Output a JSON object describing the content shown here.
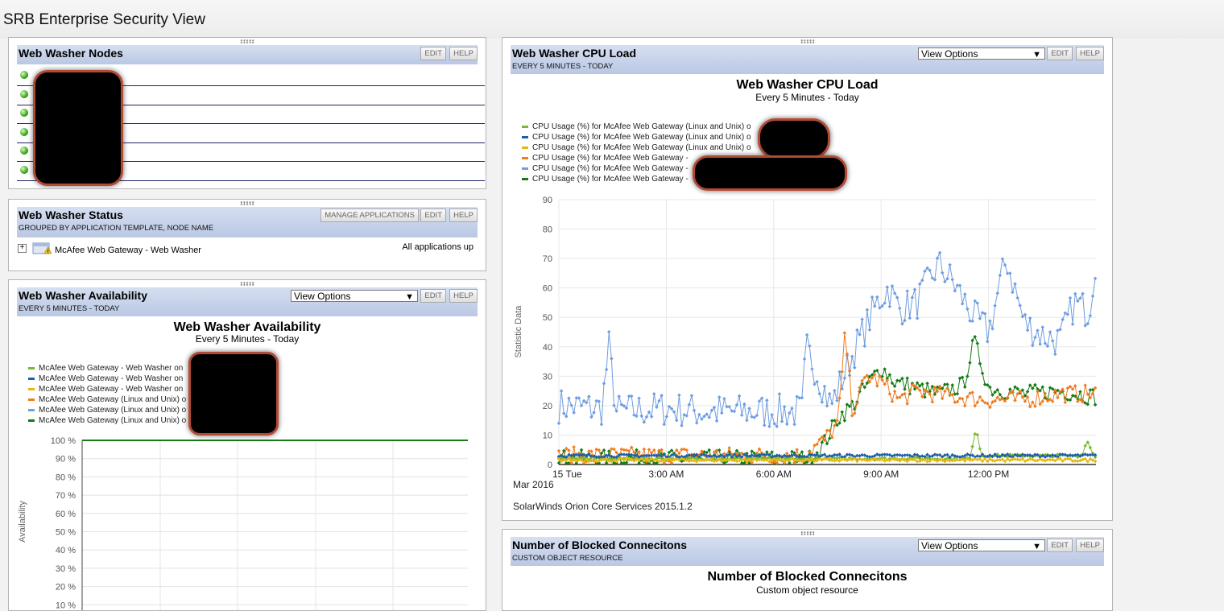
{
  "page": {
    "title": "SRB Enterprise Security View"
  },
  "common": {
    "edit": "EDIT",
    "help": "HELP",
    "view_options": "View Options"
  },
  "nodes_panel": {
    "title": "Web Washer Nodes",
    "row_count": 6
  },
  "status_panel": {
    "title": "Web Washer Status",
    "subtitle": "GROUPED BY APPLICATION TEMPLATE, NODE NAME",
    "manage_label": "MANAGE APPLICATIONS",
    "group_label": "McAfee Web Gateway - Web Washer",
    "status_text": "All applications up"
  },
  "availability_panel": {
    "title": "Web Washer Availability",
    "subtitle": "EVERY 5 MINUTES - TODAY",
    "chart_title": "Web Washer Availability",
    "chart_subtitle": "Every 5 Minutes - Today",
    "legend": [
      {
        "label": "McAfee Web Gateway - Web Washer on",
        "color": "#7cb82f"
      },
      {
        "label": "McAfee Web Gateway - Web Washer on",
        "color": "#1f5fa8"
      },
      {
        "label": "McAfee Web Gateway - Web Washer on",
        "color": "#e3b814"
      },
      {
        "label": "McAfee Web Gateway (Linux and Unix) o",
        "color": "#f07c1e"
      },
      {
        "label": "McAfee Web Gateway (Linux and Unix) o",
        "color": "#6e9de0"
      },
      {
        "label": "McAfee Web Gateway (Linux and Unix) o",
        "color": "#157a15"
      }
    ]
  },
  "cpu_panel": {
    "title": "Web Washer CPU Load",
    "subtitle": "EVERY 5 MINUTES - TODAY",
    "chart_title": "Web Washer CPU Load",
    "chart_subtitle": "Every 5 Minutes - Today",
    "footer": "SolarWinds Orion Core Services 2015.1.2",
    "legend": [
      {
        "label": "CPU Usage (%) for McAfee Web Gateway (Linux and Unix) o",
        "color": "#7cb82f"
      },
      {
        "label": "CPU Usage (%) for McAfee Web Gateway (Linux and Unix) o",
        "color": "#1f5fa8"
      },
      {
        "label": "CPU Usage (%) for McAfee Web Gateway (Linux and Unix) o",
        "color": "#e3b814"
      },
      {
        "label": "CPU Usage (%) for McAfee Web Gateway -",
        "color": "#f07c1e"
      },
      {
        "label": "CPU Usage (%) for McAfee Web Gateway -",
        "color": "#6e9de0"
      },
      {
        "label": "CPU Usage (%) for McAfee Web Gateway -",
        "color": "#157a15"
      }
    ]
  },
  "blocked_panel": {
    "title": "Number of Blocked Connecitons",
    "subtitle": "CUSTOM OBJECT RESOURCE",
    "chart_title": "Number of Blocked Connecitons",
    "chart_subtitle": "Custom object resource"
  },
  "chart_data": [
    {
      "type": "line",
      "title": "Web Washer Availability",
      "subtitle": "Every 5 Minutes - Today",
      "ylabel": "Availability",
      "y_tick_labels": [
        "100 %",
        "90 %",
        "80 %",
        "70 %",
        "60 %",
        "50 %",
        "40 %",
        "30 %",
        "20 %",
        "10 %"
      ],
      "ylim": [
        0,
        100
      ],
      "grid": true,
      "series": [
        {
          "name": "McAfee Web Gateway (Linux and Unix) o",
          "color": "#157a15",
          "values": [
            100,
            100
          ]
        }
      ]
    },
    {
      "type": "line",
      "title": "Web Washer CPU Load",
      "subtitle": "Every 5 Minutes - Today",
      "ylabel": "Statistic Data",
      "ylim": [
        0,
        90
      ],
      "yticks": [
        0,
        10,
        20,
        30,
        40,
        50,
        60,
        70,
        80,
        90
      ],
      "x_tick_labels": [
        "15 Tue",
        "3:00 AM",
        "6:00 AM",
        "9:00 AM",
        "12:00 PM"
      ],
      "x_tick_hours": [
        0,
        3,
        6,
        9,
        12
      ],
      "x_sublabel": "Mar 2016",
      "x_range_hours": [
        0,
        15
      ],
      "grid": true,
      "series": [
        {
          "color": "#6e9de0",
          "anchors": [
            [
              0,
              20
            ],
            [
              1.2,
              19
            ],
            [
              1.4,
              40
            ],
            [
              1.6,
              18
            ],
            [
              3,
              19
            ],
            [
              4,
              18
            ],
            [
              5,
              18
            ],
            [
              6.8,
              18
            ],
            [
              6.9,
              40
            ],
            [
              7.6,
              20
            ],
            [
              8.3,
              40
            ],
            [
              8.9,
              55
            ],
            [
              9.2,
              60
            ],
            [
              9.5,
              53
            ],
            [
              10,
              55
            ],
            [
              10.6,
              68
            ],
            [
              11,
              62
            ],
            [
              11.6,
              50
            ],
            [
              12,
              45
            ],
            [
              12.5,
              70
            ],
            [
              13,
              48
            ],
            [
              13.5,
              44
            ],
            [
              14,
              42
            ],
            [
              14.4,
              55
            ],
            [
              14.8,
              52
            ],
            [
              15,
              70
            ]
          ]
        },
        {
          "color": "#157a15",
          "anchors": [
            [
              0,
              2
            ],
            [
              7,
              2
            ],
            [
              7.4,
              7
            ],
            [
              7.8,
              16
            ],
            [
              8.2,
              20
            ],
            [
              8.6,
              27
            ],
            [
              9,
              33
            ],
            [
              9.4,
              28
            ],
            [
              10,
              26
            ],
            [
              10.6,
              24
            ],
            [
              11.3,
              27
            ],
            [
              11.6,
              42
            ],
            [
              12,
              26
            ],
            [
              13,
              24
            ],
            [
              14,
              25
            ],
            [
              15,
              23
            ]
          ]
        },
        {
          "color": "#f07c1e",
          "anchors": [
            [
              0,
              3
            ],
            [
              6.8,
              3
            ],
            [
              7.4,
              8
            ],
            [
              7.8,
              14
            ],
            [
              8.0,
              45
            ],
            [
              8.2,
              18
            ],
            [
              8.6,
              30
            ],
            [
              9,
              28
            ],
            [
              9.5,
              22
            ],
            [
              10,
              25
            ],
            [
              11,
              23
            ],
            [
              12,
              22
            ],
            [
              13,
              22
            ],
            [
              14,
              24
            ],
            [
              15,
              24
            ]
          ]
        },
        {
          "color": "#7cb82f",
          "anchors": [
            [
              0,
              2
            ],
            [
              11.5,
              2
            ],
            [
              11.65,
              13
            ],
            [
              11.8,
              3
            ],
            [
              14.6,
              3
            ],
            [
              14.75,
              8
            ],
            [
              15,
              2
            ]
          ]
        },
        {
          "color": "#1f5fa8",
          "anchors": [
            [
              0,
              3
            ],
            [
              15,
              3
            ]
          ]
        },
        {
          "color": "#e3b814",
          "anchors": [
            [
              0,
              1.5
            ],
            [
              15,
              1.5
            ]
          ]
        }
      ]
    }
  ]
}
